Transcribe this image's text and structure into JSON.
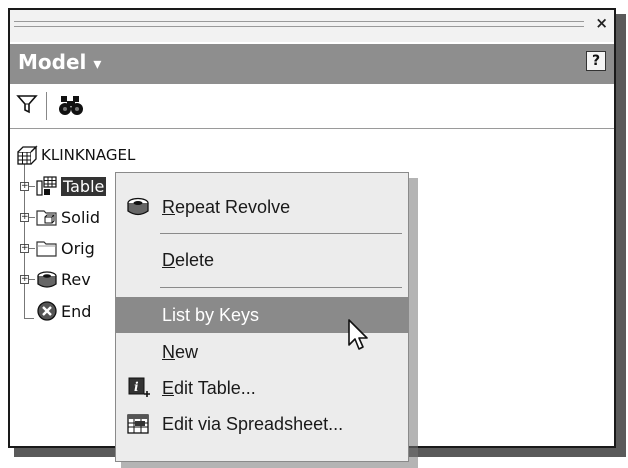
{
  "panel": {
    "close_glyph": "×",
    "header_title": "Model",
    "header_caret": "▾",
    "help_glyph": "?"
  },
  "toolbar": {
    "filter_icon": "filter-icon",
    "find_icon": "binoculars-icon"
  },
  "tree": {
    "root": "KLINKNAGEL",
    "items": [
      {
        "label": "Table",
        "icon": "table-icon",
        "selected": true
      },
      {
        "label": "Solid",
        "icon": "solid-bodies-icon"
      },
      {
        "label": "Orig",
        "icon": "origin-folder-icon"
      },
      {
        "label": "Rev",
        "icon": "revolve-icon"
      },
      {
        "label": "End",
        "icon": "end-of-part-icon"
      }
    ]
  },
  "context_menu": {
    "items": [
      {
        "label": "Repeat Revolve",
        "accel": "R",
        "rest": "epeat Revolve",
        "icon": "revolve-icon"
      },
      {
        "label": "Delete",
        "accel": "D",
        "rest": "elete"
      },
      {
        "label": "List by Keys",
        "highlighted": true
      },
      {
        "label": "New",
        "accel": "N",
        "rest": "ew"
      },
      {
        "label": "Edit Table...",
        "accel": "E",
        "rest": "dit Table...",
        "icon": "edit-table-icon"
      },
      {
        "label": "Edit via Spreadsheet...",
        "icon": "spreadsheet-icon"
      }
    ]
  },
  "colors": {
    "header_bg": "#8e8e8e",
    "menu_bg": "#ececec",
    "highlight_bg": "#8a8a8a"
  }
}
